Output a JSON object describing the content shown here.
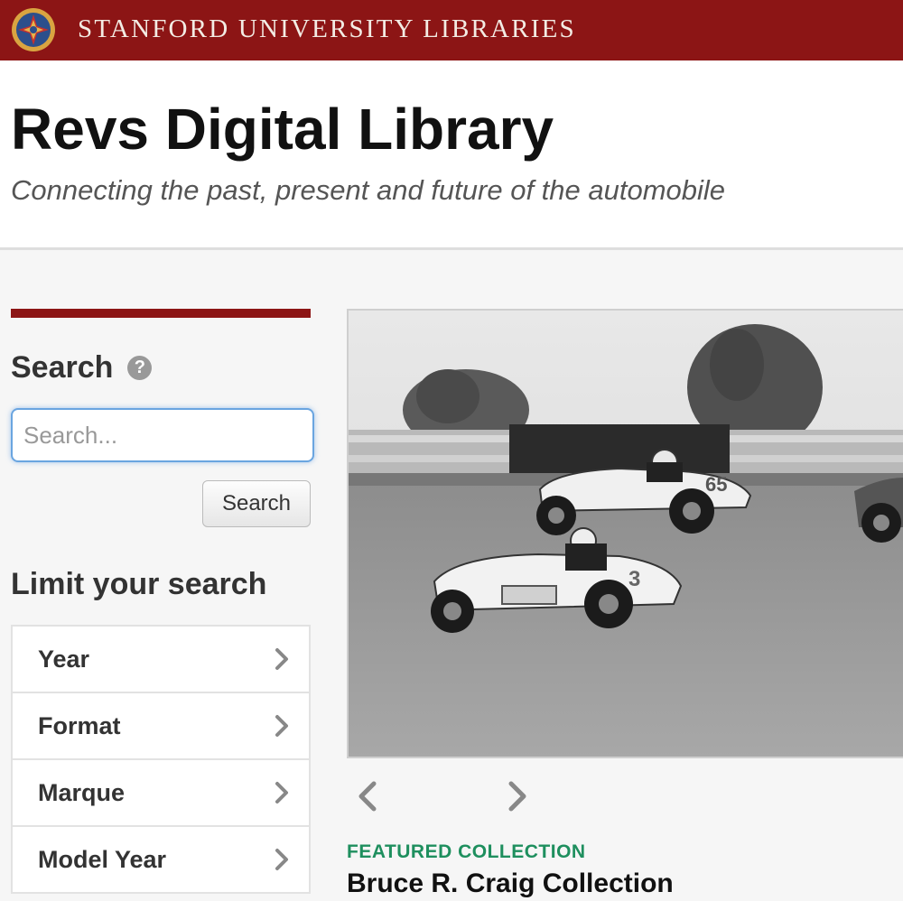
{
  "brand": {
    "name": "STANFORD UNIVERSITY LIBRARIES",
    "color": "#8c1515"
  },
  "masthead": {
    "title": "Revs Digital Library",
    "tagline": "Connecting the past, present and future of the automobile"
  },
  "sidebar": {
    "search_heading": "Search",
    "search_placeholder": "Search...",
    "search_value": "",
    "search_button_label": "Search",
    "limit_heading": "Limit your search",
    "facets": [
      {
        "label": "Year"
      },
      {
        "label": "Format"
      },
      {
        "label": "Marque"
      },
      {
        "label": "Model Year"
      }
    ]
  },
  "carousel": {
    "image_icon": "racing-cars-photo",
    "prev_icon": "chevron-left-icon",
    "next_icon": "chevron-right-icon",
    "featured_label": "FEATURED COLLECTION",
    "featured_title": "Bruce R. Craig Collection"
  }
}
